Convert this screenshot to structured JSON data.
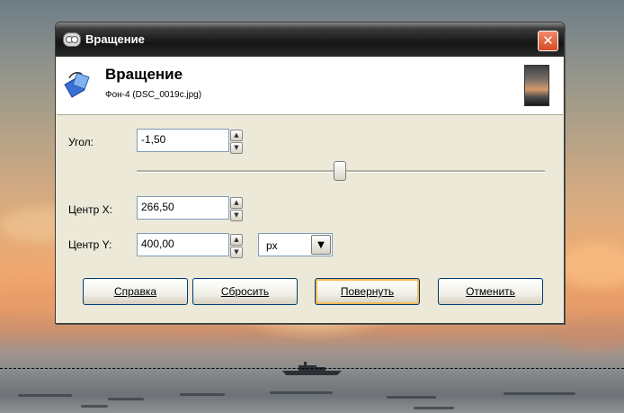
{
  "window": {
    "title": "Вращение",
    "close_glyph": "✕"
  },
  "header": {
    "title": "Вращение",
    "subtitle": "Фон-4 (DSC_0019c.jpg)"
  },
  "angle": {
    "label": "Угол:",
    "value": "-1,50"
  },
  "center_x": {
    "label": "Центр X:",
    "value": "266,50"
  },
  "center_y": {
    "label": "Центр Y:",
    "value": "400,00"
  },
  "unit": {
    "selected": "px"
  },
  "buttons": {
    "help": "Справка",
    "reset": "Сбросить",
    "rotate": "Повернуть",
    "cancel": "Отменить"
  },
  "colors": {
    "titlebar": "#1a1a1a",
    "close_button": "#e05a35",
    "dialog_bg": "#ece9d8",
    "default_button_highlight": "#f8b955"
  },
  "icons": {
    "app": "gimp-wilber-icon",
    "rotate": "rotate-tool-icon",
    "spin_up": "▲",
    "spin_down": "▼",
    "dropdown": "▼"
  }
}
